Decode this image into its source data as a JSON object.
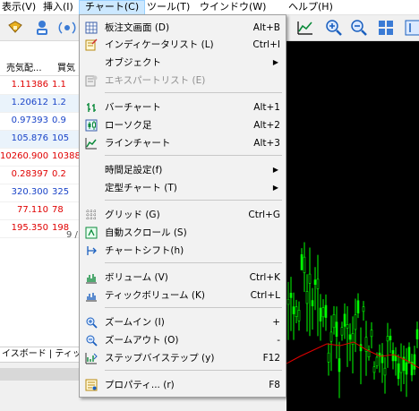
{
  "menubar": {
    "items": [
      {
        "label": "表示(V)"
      },
      {
        "label": "挿入(I)"
      },
      {
        "label": "チャート(C)"
      },
      {
        "label": "ツール(T)"
      },
      {
        "label": "ウインドウ(W)"
      },
      {
        "label": "ヘルプ(H)"
      }
    ]
  },
  "market_watch": {
    "headers": [
      "売気配...",
      "買気"
    ],
    "rows": [
      {
        "bid": "1.11386",
        "ask": "1.1",
        "color": "red"
      },
      {
        "bid": "1.20612",
        "ask": "1.2",
        "color": "blue"
      },
      {
        "bid": "0.97393",
        "ask": "0.9",
        "color": "blue"
      },
      {
        "bid": "105.876",
        "ask": "105",
        "color": "blue"
      },
      {
        "bid": "10260.900",
        "ask": "10388",
        "color": "red"
      },
      {
        "bid": "0.28397",
        "ask": "0.2",
        "color": "red"
      },
      {
        "bid": "320.300",
        "ask": "325",
        "color": "blue"
      },
      {
        "bid": "77.110",
        "ask": "78",
        "color": "red"
      },
      {
        "bid": "195.350",
        "ask": "198",
        "color": "red"
      }
    ],
    "count": "9 /",
    "tabs": "イスボード | ティック"
  },
  "chart_menu": {
    "items": [
      {
        "label": "板注文画面 (D)",
        "shortcut": "Alt+B",
        "icon": "order-book-icon"
      },
      {
        "label": "インディケータリスト (L)",
        "shortcut": "Ctrl+I",
        "icon": "indicator-list-icon"
      },
      {
        "label": "オブジェクト",
        "shortcut": "",
        "icon": "",
        "submenu": true
      },
      {
        "label": "エキスパートリスト (E)",
        "shortcut": "",
        "icon": "expert-list-icon",
        "disabled": true
      },
      {
        "label": "バーチャート",
        "shortcut": "Alt+1",
        "icon": "bar-chart-icon"
      },
      {
        "label": "ローソク足",
        "shortcut": "Alt+2",
        "icon": "candlestick-icon"
      },
      {
        "label": "ラインチャート",
        "shortcut": "Alt+3",
        "icon": "line-chart-icon"
      },
      {
        "label": "時間足設定(f)",
        "shortcut": "",
        "icon": "",
        "submenu": true
      },
      {
        "label": "定型チャート (T)",
        "shortcut": "",
        "icon": "",
        "submenu": true
      },
      {
        "label": "グリッド (G)",
        "shortcut": "Ctrl+G",
        "icon": "grid-icon"
      },
      {
        "label": "自動スクロール (S)",
        "shortcut": "",
        "icon": "auto-scroll-icon"
      },
      {
        "label": "チャートシフト(h)",
        "shortcut": "",
        "icon": "chart-shift-icon"
      },
      {
        "label": "ボリューム (V)",
        "shortcut": "Ctrl+K",
        "icon": "volume-icon"
      },
      {
        "label": "ティックボリューム (K)",
        "shortcut": "Ctrl+L",
        "icon": "tick-volume-icon"
      },
      {
        "label": "ズームイン (I)",
        "shortcut": "+",
        "icon": "zoom-in-icon"
      },
      {
        "label": "ズームアウト (O)",
        "shortcut": "-",
        "icon": "zoom-out-icon"
      },
      {
        "label": "ステップバイステップ (y)",
        "shortcut": "F12",
        "icon": "step-by-step-icon"
      },
      {
        "label": "プロパティ... (r)",
        "shortcut": "F8",
        "icon": "properties-icon"
      }
    ]
  },
  "colors": {
    "bid_red": "#e00000",
    "bid_blue": "#1a44c8",
    "chart_background": "#000000",
    "candle_color": "#00ff00",
    "moving_average": "#e00000"
  }
}
